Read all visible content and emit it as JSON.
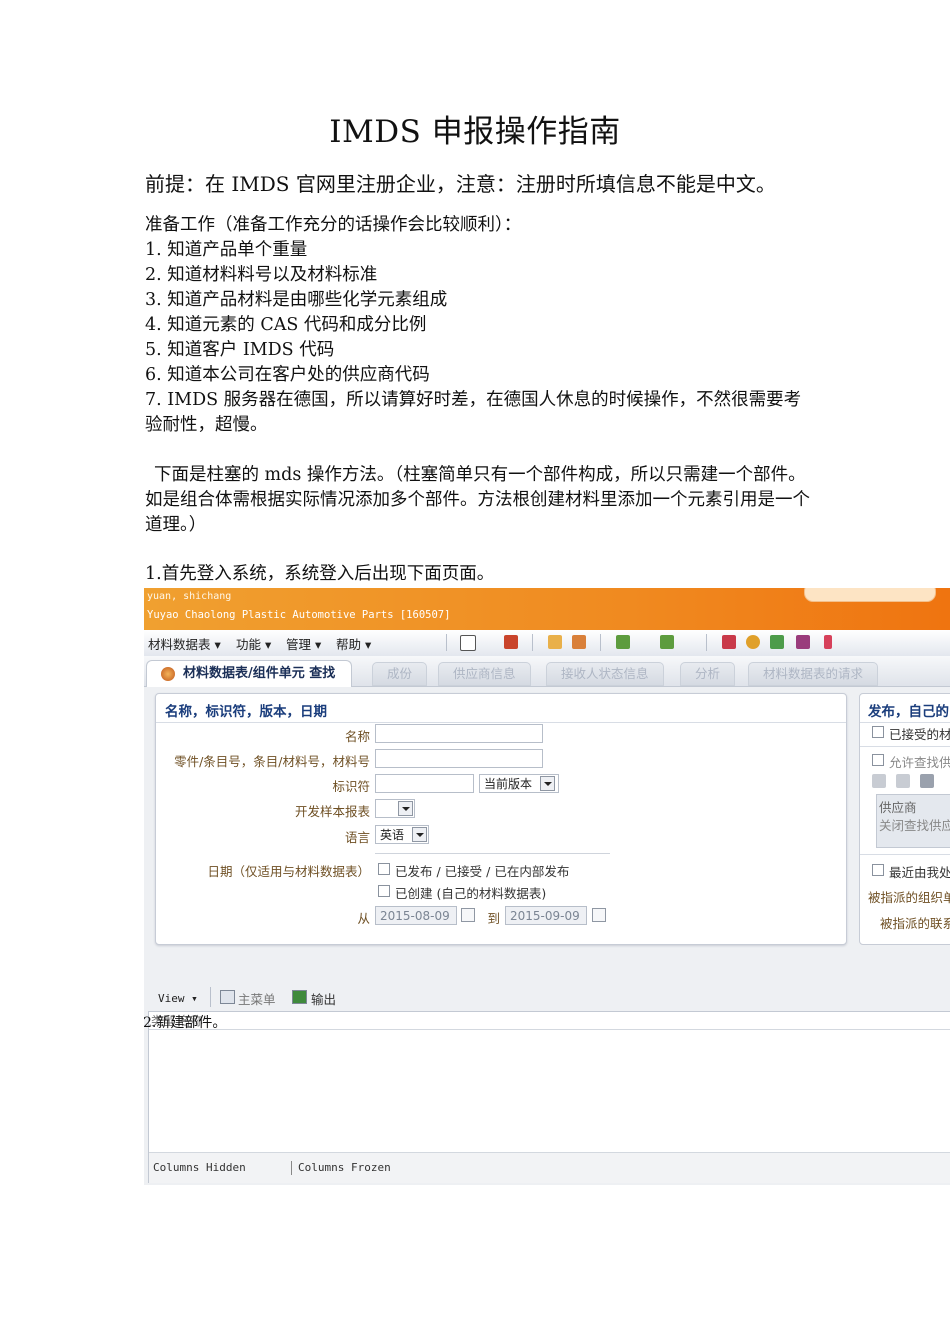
{
  "title": "IMDS 申报操作指南",
  "premise": "前提：在 IMDS 官网里注册企业，注意：注册时所填信息不能是中文。",
  "prep_heading": "准备工作（准备工作充分的话操作会比较顺利）：",
  "prep_items": [
    "1.  知道产品单个重量",
    "2.  知道材料料号以及材料标准",
    "3.  知道产品材料是由哪些化学元素组成",
    "4.  知道元素的 CAS 代码和成分比例",
    "5.  知道客户 IMDS 代码",
    "6.  知道本公司在客户处的供应商代码",
    "7.  IMDS 服务器在德国，所以请算好时差，在德国人休息的时候操作，不然很需要考验耐性，超慢。"
  ],
  "intro_paragraph": "下面是柱塞的 mds 操作方法。（柱塞简单只有一个部件构成，所以只需建一个部件。如是组合体需根据实际情况添加多个部件。方法根创建材料里添加一个元素引用是一个道理。）",
  "step1": "1.首先登入系统，系统登入后出现下面页面。",
  "screenshot": {
    "user": "yuan, shichang",
    "company": "Yuyao Chaolong Plastic Automotive Parts [160507]",
    "menu": [
      "材料数据表",
      "功能",
      "管理",
      "帮助"
    ],
    "active_tab": "材料数据表/组件单元 查找",
    "tabs": [
      "成份",
      "供应商信息",
      "接收人状态信息",
      "分析",
      "材料数据表的请求"
    ],
    "search_panel": {
      "heading": "名称，标识符，版本，日期",
      "label_name": "名称",
      "label_part": "零件/条目号，条目/材料号，材料号",
      "label_id": "标识符",
      "version_value": "当前版本",
      "label_sample": "开发样本报表",
      "label_lang": "语言",
      "lang_value": "英语",
      "label_date": "日期（仅适用与材料数据表）",
      "opt_published": "已发布 / 已接受 / 已在内部发布",
      "opt_created": "已创建 (自己的材料数据表)",
      "from_label": "从",
      "from_date": "2015-08-09",
      "to_label": "到",
      "to_date": "2015-09-09"
    },
    "right_panel": {
      "heading": "发布，自己的",
      "opt1": "已接受的材",
      "opt2": "允许查找供",
      "supplier": "供应商",
      "close_search": "关闭查找供应",
      "recent": "最近由我处",
      "assigned_org": "被指派的组织单",
      "assigned_contact": "被指派的联系"
    },
    "viewbar": {
      "view": "View",
      "main_menu": "主菜单",
      "export": "输出"
    },
    "grid_overlay": "2.新建部件。",
    "grid_ghost": "类型 名称",
    "footer": [
      "Columns Hidden",
      "Columns Frozen"
    ]
  }
}
